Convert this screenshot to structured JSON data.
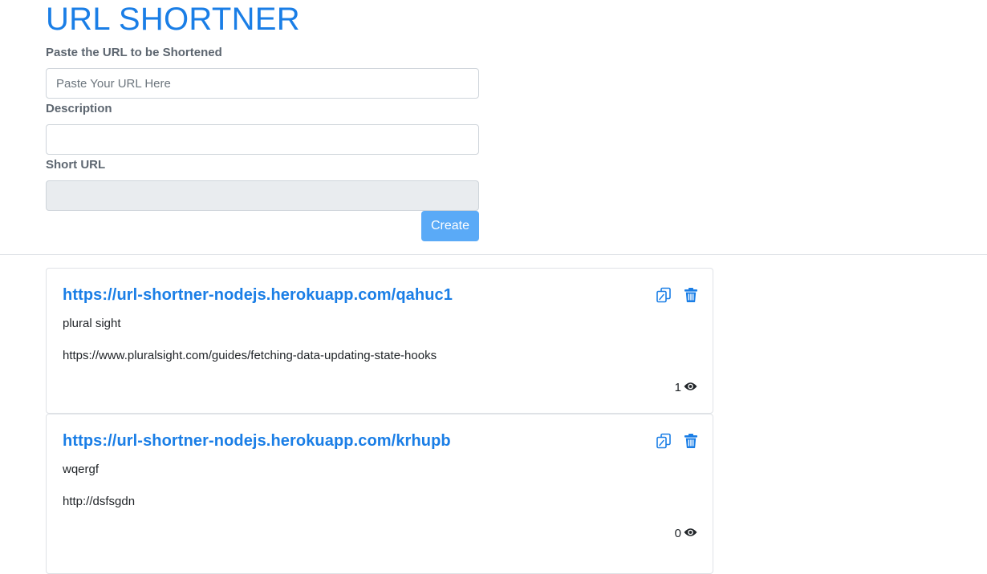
{
  "page": {
    "title": "URL SHORTNER"
  },
  "form": {
    "url_label": "Paste the URL to be Shortened",
    "url_placeholder": "Paste Your URL Here",
    "url_value": "",
    "description_label": "Description",
    "description_value": "",
    "short_url_label": "Short URL",
    "short_url_value": "",
    "create_label": "Create"
  },
  "colors": {
    "accent": "#1a7ee6",
    "button": "#5aaaf7"
  },
  "icons": {
    "copy": "copy-icon",
    "delete": "trash-icon",
    "views": "eye-icon"
  },
  "links": [
    {
      "short_url": "https://url-shortner-nodejs.herokuapp.com/qahuc1",
      "description": "plural sight",
      "original_url": "https://www.pluralsight.com/guides/fetching-data-updating-state-hooks",
      "views": "1"
    },
    {
      "short_url": "https://url-shortner-nodejs.herokuapp.com/krhupb",
      "description": "wqergf",
      "original_url": "http://dsfsgdn",
      "views": "0"
    }
  ]
}
